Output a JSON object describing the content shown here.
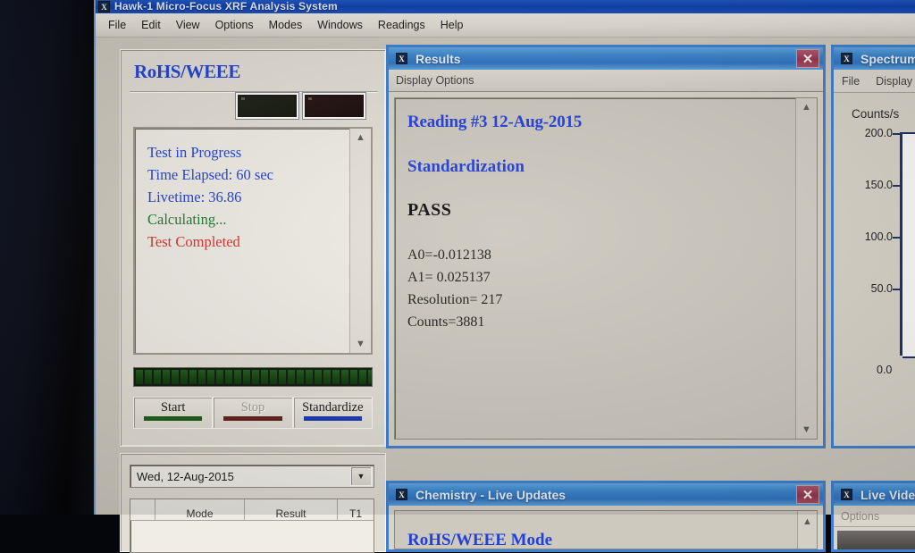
{
  "app": {
    "title": "Hawk-1 Micro-Focus XRF Analysis System",
    "icon": "x-app-icon",
    "menus": [
      "File",
      "Edit",
      "View",
      "Options",
      "Modes",
      "Windows",
      "Readings",
      "Help"
    ]
  },
  "left_panel": {
    "title": "RoHS/WEEE",
    "indicators": [
      {
        "name": "green-status-led",
        "color": "#1d2016"
      },
      {
        "name": "red-status-led",
        "color": "#241310"
      }
    ],
    "status_lines": [
      {
        "text": "Test in Progress",
        "color": "#2340d8"
      },
      {
        "text": "Time Elapsed: 60 sec",
        "color": "#2340d8"
      },
      {
        "text": "Livetime: 36.86",
        "color": "#2340d8"
      },
      {
        "text": "Calculating...",
        "color": "#1d7a2e"
      },
      {
        "text": "Test Completed",
        "color": "#d6342c"
      }
    ],
    "progress": {
      "percent": 100,
      "segments": 28,
      "color": "#1c5d17"
    },
    "buttons": [
      {
        "label": "Start",
        "accent": "#1c5d17",
        "enabled": true
      },
      {
        "label": "Stop",
        "accent": "#641f1c",
        "enabled": false
      },
      {
        "label": "Standardize",
        "accent": "#1a39b6",
        "enabled": true
      }
    ]
  },
  "readings_panel": {
    "date_value": "Wed, 12-Aug-2015",
    "dropdown_icon": "chevron-down-icon",
    "table_headers": [
      "",
      "Mode",
      "Result",
      "T1"
    ]
  },
  "results_window": {
    "title": "Results",
    "icon": "x-app-icon",
    "close_icon": "close-icon",
    "menus": [
      "Display Options"
    ],
    "reading_heading": "Reading #3 12-Aug-2015",
    "section_heading": "Standardization",
    "verdict": "PASS",
    "parameters": [
      "A0=-0.012138",
      "A1= 0.025137",
      "Resolution= 217",
      "Counts=3881"
    ],
    "scroll_up_icon": "chevron-up-icon",
    "scroll_down_icon": "chevron-down-icon"
  },
  "spectrum_window": {
    "title": "Spectrum",
    "icon": "x-app-icon",
    "menus": [
      "File",
      "Display"
    ],
    "axis_label": "Counts/s",
    "y_ticks": [
      "200.0",
      "150.0",
      "100.0",
      "50.0"
    ],
    "y_zero": "0.0"
  },
  "chemistry_window": {
    "title": "Chemistry - Live Updates",
    "icon": "x-app-icon",
    "close_icon": "close-icon",
    "clipped_text": "RoHS/WEEE Mode",
    "scroll_up_icon": "chevron-up-icon"
  },
  "video_window": {
    "title": "Live Video",
    "icon": "x-app-icon",
    "menus": [
      "Options"
    ]
  },
  "chart_data": {
    "type": "line",
    "title": "Spectrum",
    "ylabel": "Counts/s",
    "xlabel": "",
    "y_ticks": [
      200.0,
      150.0,
      100.0,
      50.0,
      0.0
    ],
    "ylim": [
      0,
      225
    ],
    "grid": false,
    "series": [
      {
        "name": "spectrum",
        "values": []
      }
    ],
    "note": "Plot area is clipped off the right edge of the screenshot; only the y-axis is visible."
  }
}
